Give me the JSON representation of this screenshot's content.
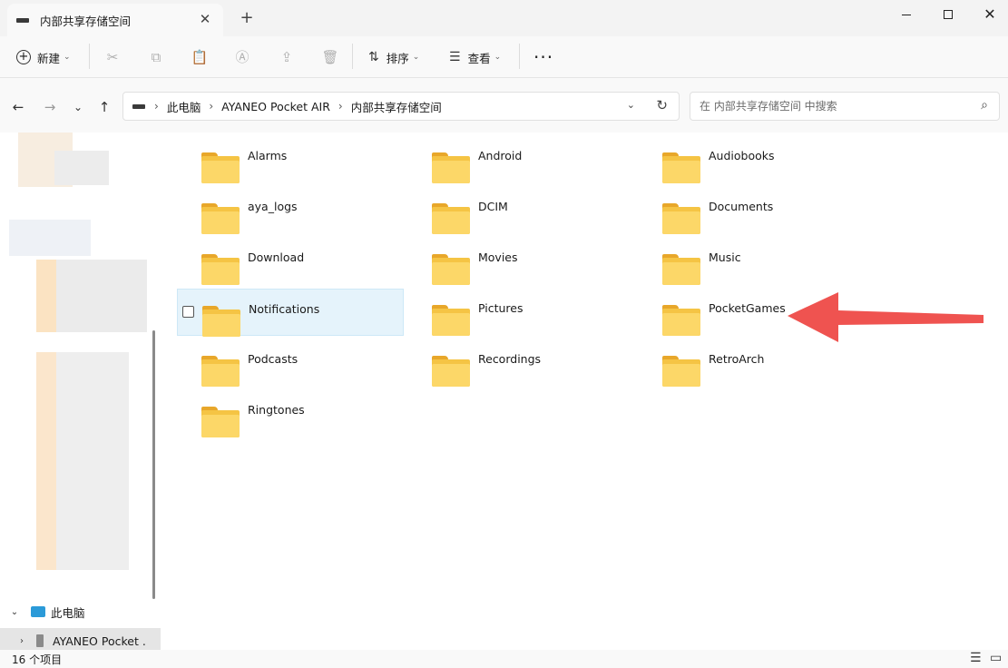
{
  "window": {
    "tab_title": "内部共享存储空间",
    "close_glyph": "✕",
    "new_tab_glyph": "+",
    "minimize_glyph": "",
    "close_window_glyph": "✕"
  },
  "toolbar": {
    "new_label": "新建",
    "sort_label": "排序",
    "view_label": "查看",
    "more_glyph": "···",
    "icons": [
      "cut-icon",
      "copy-icon",
      "paste-icon",
      "rename-icon",
      "share-icon",
      "delete-icon"
    ]
  },
  "navigation": {
    "back_glyph": "←",
    "forward_glyph": "→",
    "recent_glyph": "⌄",
    "up_glyph": "↑"
  },
  "address": {
    "breadcrumbs": [
      "此电脑",
      "AYANEO Pocket AIR",
      "内部共享存储空间"
    ],
    "separator": "›"
  },
  "search": {
    "placeholder": "在 内部共享存储空间 中搜索"
  },
  "sidebar": {
    "this_pc_label": "此电脑",
    "device_label": "AYANEO Pocket ."
  },
  "folders": [
    "Alarms",
    "Android",
    "Audiobooks",
    "aya_logs",
    "DCIM",
    "Documents",
    "Download",
    "Movies",
    "Music",
    "Notifications",
    "Pictures",
    "PocketGames",
    "Podcasts",
    "Recordings",
    "RetroArch",
    "Ringtones"
  ],
  "selected_folder": "Notifications",
  "annotation": {
    "arrow_color": "#ef5350",
    "points_to": "PocketGames"
  },
  "status": {
    "item_count": "16 个项目"
  },
  "colors": {
    "folder_back": "#f5c444",
    "folder_front": "#fcd768",
    "selection": "#e5f3fb"
  }
}
